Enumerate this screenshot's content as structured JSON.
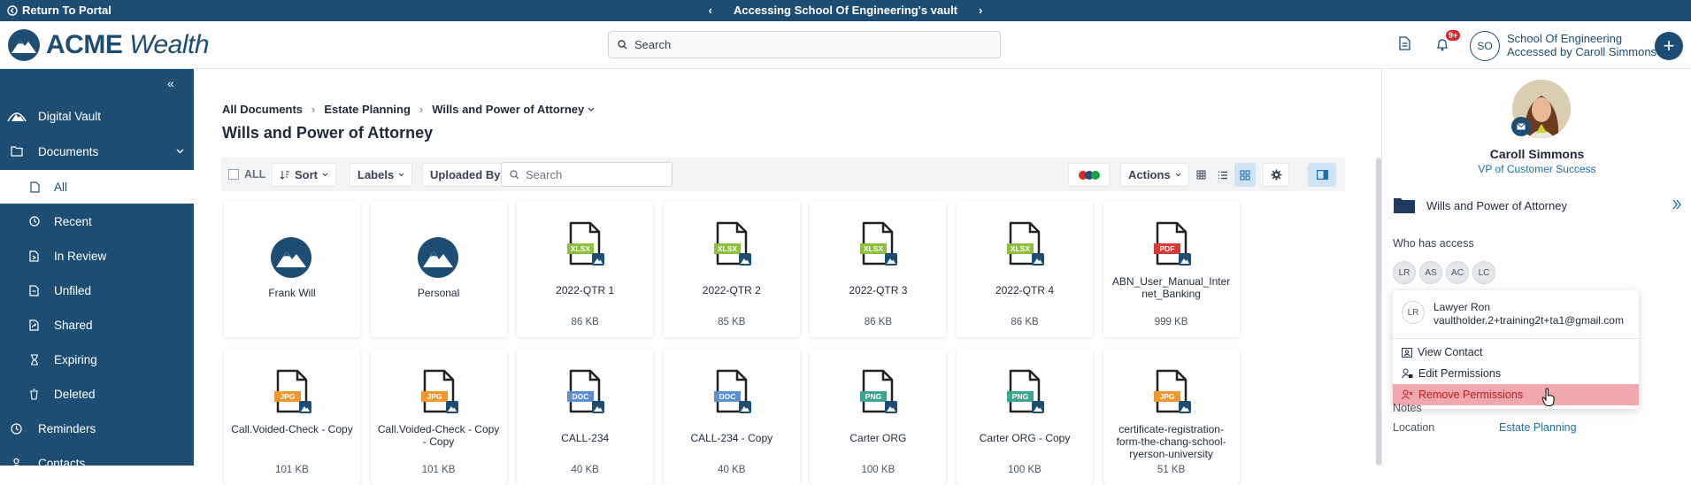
{
  "topbar": {
    "return_label": "Return To Portal",
    "vault_title": "Accessing School Of Engineering's vault"
  },
  "header": {
    "logo_text_bold": "ACME",
    "logo_text_italic": "Wealth",
    "search_placeholder": "Search",
    "notification_count": "9+",
    "account_initials": "SO",
    "account_name": "School Of Engineering",
    "account_sub": "Accessed by Caroll Simmons"
  },
  "sidebar": {
    "items": [
      {
        "label": "Digital Vault",
        "icon": "mountain-icon"
      },
      {
        "label": "Documents",
        "icon": "folder-icon"
      },
      {
        "label": "All",
        "icon": "file-icon"
      },
      {
        "label": "Recent",
        "icon": "clock-icon"
      },
      {
        "label": "In Review",
        "icon": "review-icon"
      },
      {
        "label": "Unfiled",
        "icon": "unfiled-icon"
      },
      {
        "label": "Shared",
        "icon": "share-icon"
      },
      {
        "label": "Expiring",
        "icon": "hourglass-icon"
      },
      {
        "label": "Deleted",
        "icon": "trash-icon"
      },
      {
        "label": "Reminders",
        "icon": "clock-icon"
      },
      {
        "label": "Contacts",
        "icon": "contacts-icon"
      }
    ]
  },
  "main": {
    "breadcrumb": [
      "All Documents",
      "Estate Planning",
      "Wills and Power of Attorney"
    ],
    "title": "Wills and Power of Attorney",
    "toolbar": {
      "all_label": "ALL",
      "sort_label": "Sort",
      "labels_label": "Labels",
      "uploaded_by_label": "Uploaded By",
      "search_placeholder": "Search",
      "actions_label": "Actions"
    },
    "files": [
      {
        "name": "Frank Will",
        "size": "",
        "type": "vault"
      },
      {
        "name": "Personal",
        "size": "",
        "type": "vault"
      },
      {
        "name": "2022-QTR 1",
        "size": "86 KB",
        "type": "XLSX"
      },
      {
        "name": "2022-QTR 2",
        "size": "85 KB",
        "type": "XLSX"
      },
      {
        "name": "2022-QTR 3",
        "size": "86 KB",
        "type": "XLSX"
      },
      {
        "name": "2022-QTR 4",
        "size": "86 KB",
        "type": "XLSX"
      },
      {
        "name": "ABN_User_Manual_Inter net_Banking",
        "size": "999 KB",
        "type": "PDF"
      },
      {
        "name": "Call.Voided-Check - Copy",
        "size": "101 KB",
        "type": "JPG"
      },
      {
        "name": "Call.Voided-Check - Copy - Copy",
        "size": "101 KB",
        "type": "JPG"
      },
      {
        "name": "CALL-234",
        "size": "40 KB",
        "type": "DOC"
      },
      {
        "name": "CALL-234 - Copy",
        "size": "40 KB",
        "type": "DOC"
      },
      {
        "name": "Carter ORG",
        "size": "100 KB",
        "type": "PNG"
      },
      {
        "name": "Carter ORG - Copy",
        "size": "100 KB",
        "type": "PNG"
      },
      {
        "name": "certificate-registration-form-the-chang-school-ryerson-university",
        "size": "51 KB",
        "type": "JPG"
      }
    ],
    "type_colors": {
      "XLSX": "#8bbf3c",
      "PDF": "#d83a3a",
      "JPG": "#f0962c",
      "DOC": "#5b8fd6",
      "PNG": "#3aa68f"
    }
  },
  "right_panel": {
    "person_name": "Caroll Simmons",
    "person_role": "VP of Customer Success",
    "folder_name": "Wills and Power of Attorney",
    "who_has_access_label": "Who has access",
    "access_chips": [
      "LR",
      "AS",
      "AC",
      "LC"
    ],
    "popup": {
      "initials": "LR",
      "name": "Lawyer Ron",
      "email": "vaultholder.2+training2t+ta1@gmail.com",
      "menu": [
        "View Contact",
        "Edit Permissions",
        "Remove Permissions"
      ]
    },
    "notes_label": "Notes",
    "location_label": "Location",
    "location_value": "Estate Planning"
  }
}
